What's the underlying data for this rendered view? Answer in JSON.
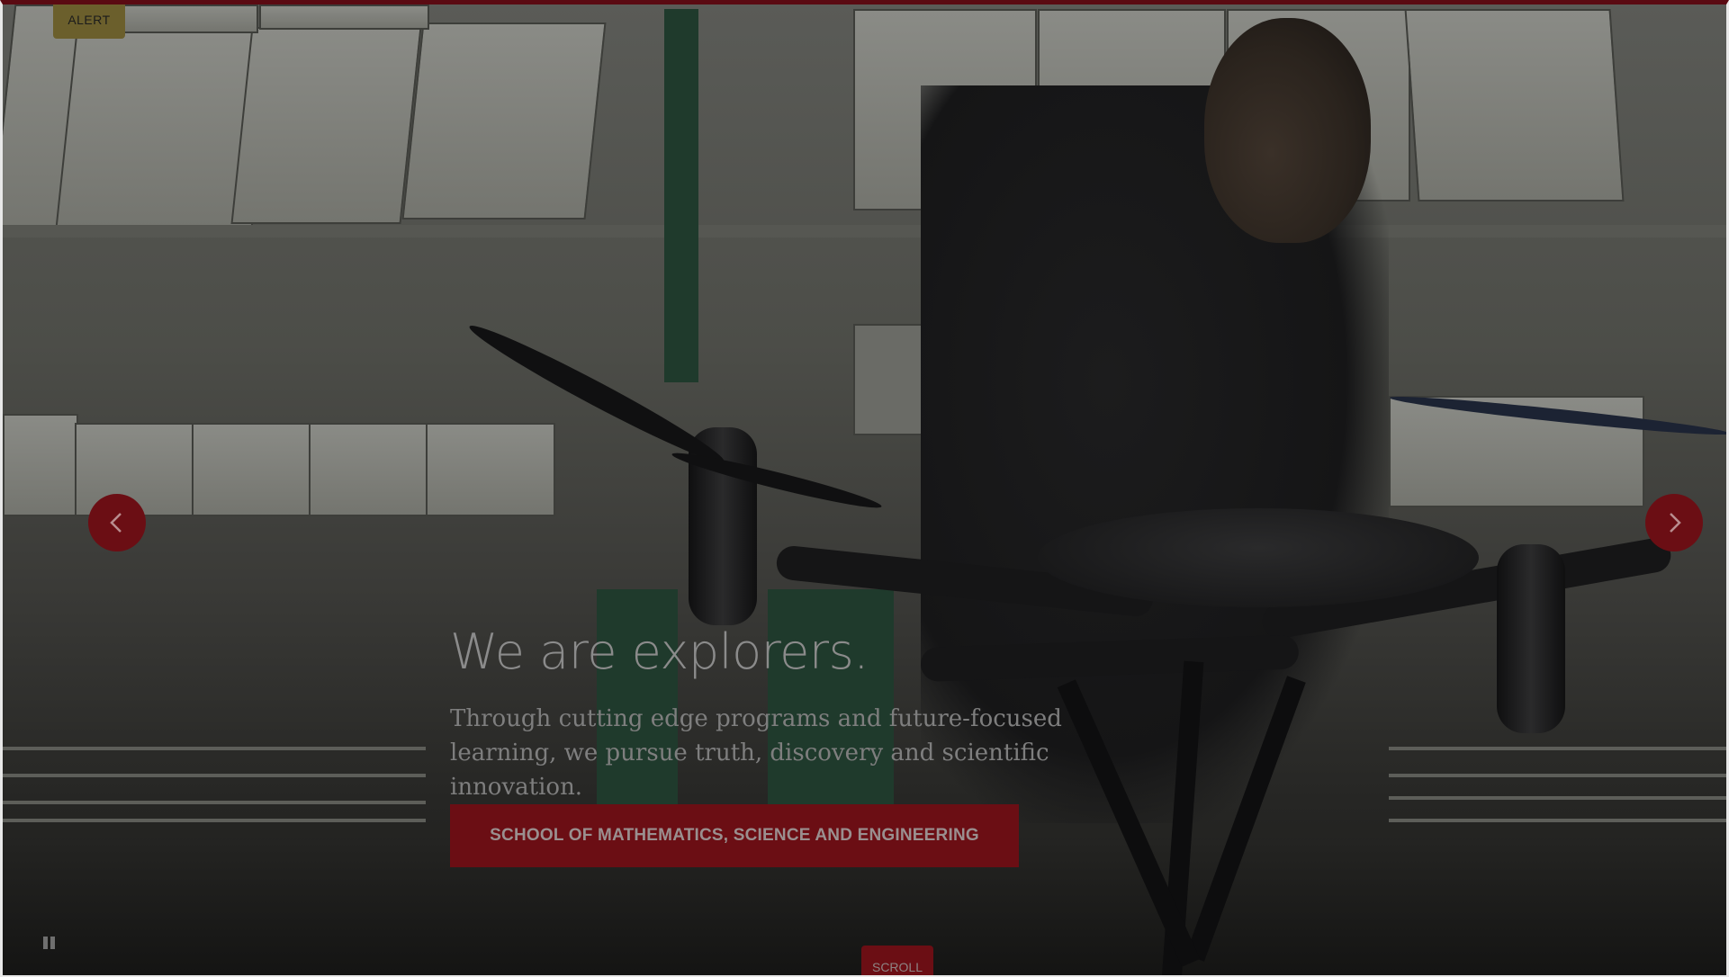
{
  "alert": {
    "label": "ALERT"
  },
  "hero": {
    "headline": "We are explorers.",
    "subtext": "Through cutting edge programs and future-focused learning, we pursue truth, discovery and scientific innovation.",
    "cta_label": "SCHOOL OF MATHEMATICS, SCIENCE AND ENGINEERING"
  },
  "carousel": {
    "prev_icon": "chevron-left-icon",
    "next_icon": "chevron-right-icon",
    "pause_icon": "pause-icon"
  },
  "scroll": {
    "label": "SCROLL"
  },
  "colors": {
    "brand_red": "#6b0e14",
    "alert_gold": "#6b5f2c",
    "top_bar": "#5a0a12"
  }
}
